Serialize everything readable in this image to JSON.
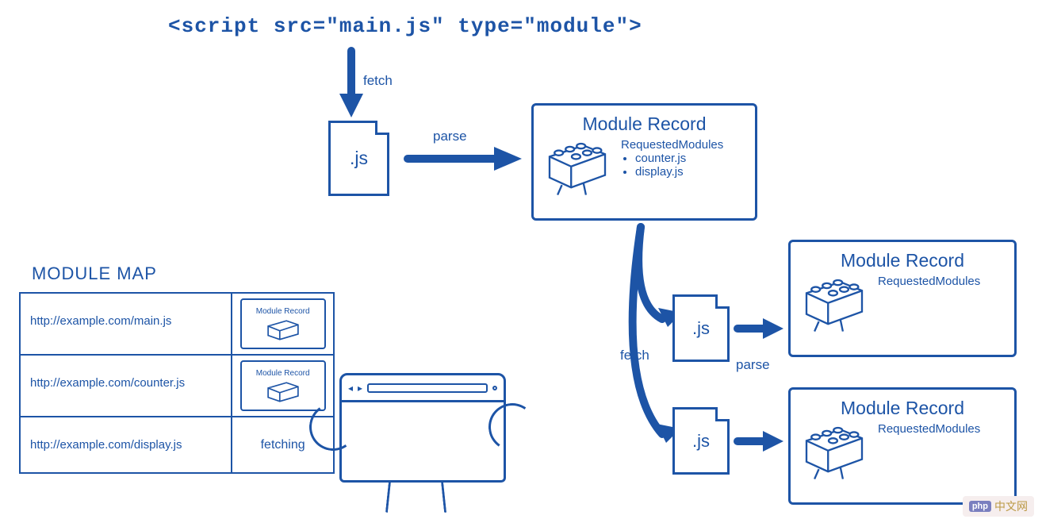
{
  "header": {
    "script_tag_text": "<script src=\"main.js\" type=\"module\">"
  },
  "labels": {
    "fetch1": "fetch",
    "parse1": "parse",
    "fetch2": "fetch",
    "parse2": "parse"
  },
  "files": {
    "main_ext": ".js",
    "counter_ext": ".js",
    "display_ext": ".js"
  },
  "records": {
    "main": {
      "title": "Module Record",
      "req_label": "RequestedModules",
      "items": [
        "counter.js",
        "display.js"
      ]
    },
    "counter": {
      "title": "Module Record",
      "req_label": "RequestedModules"
    },
    "display": {
      "title": "Module Record",
      "req_label": "RequestedModules"
    }
  },
  "module_map": {
    "title": "MODULE MAP",
    "rows": [
      {
        "url": "http://example.com/main.js",
        "value_type": "module"
      },
      {
        "url": "http://example.com/counter.js",
        "value_type": "module"
      },
      {
        "url": "http://example.com/display.js",
        "value_type": "text",
        "value_text": "fetching"
      }
    ],
    "mini_title": "Module Record"
  },
  "watermark": {
    "php": "php",
    "text": "中文网"
  }
}
